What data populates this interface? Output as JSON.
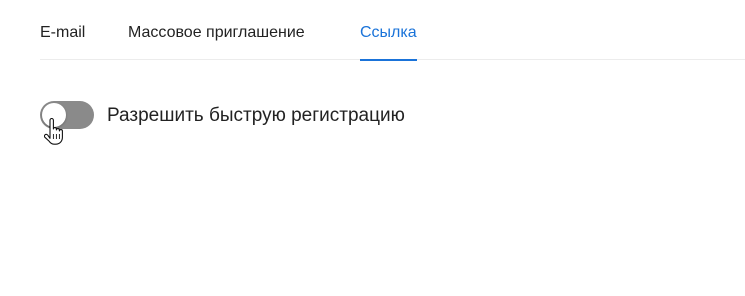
{
  "tabs": [
    {
      "label": "E-mail",
      "active": false
    },
    {
      "label": "Массовое приглашение",
      "active": false
    },
    {
      "label": "Ссылка",
      "active": true
    }
  ],
  "fast_registration": {
    "label": "Разрешить быструю регистрацию",
    "enabled": false
  },
  "colors": {
    "accent": "#1a73d9",
    "toggle_off": "#8a8a8a",
    "text": "#222222",
    "divider": "#ececec"
  },
  "icons": {
    "cursor": "hand-pointer-icon"
  }
}
